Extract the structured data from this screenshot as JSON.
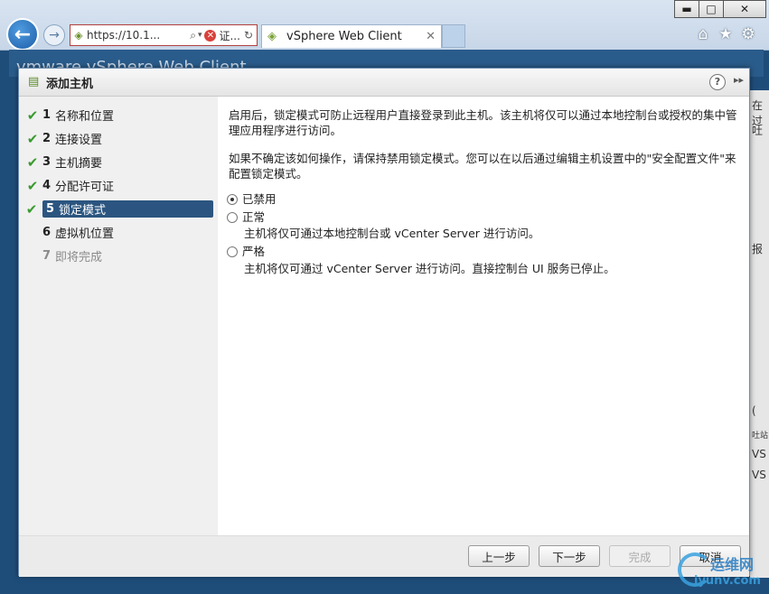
{
  "browser": {
    "address_url": "https://10.1...",
    "cert_text": "证...",
    "tab_title": "vSphere Web Client",
    "win_min": "▬",
    "win_max": "□",
    "win_close": "✕"
  },
  "background": {
    "header_text": "vmware vSphere Web Client",
    "right_fragments": [
      "在过",
      "吐",
      "报",
      "(",
      "吐站",
      "VS",
      "VS"
    ]
  },
  "dialog": {
    "title": "添加主机",
    "help": "?",
    "expand": "▸▸",
    "steps": [
      {
        "num": "1",
        "label": "名称和位置",
        "state": "done"
      },
      {
        "num": "2",
        "label": "连接设置",
        "state": "done"
      },
      {
        "num": "3",
        "label": "主机摘要",
        "state": "done"
      },
      {
        "num": "4",
        "label": "分配许可证",
        "state": "done"
      },
      {
        "num": "5",
        "label": "锁定模式",
        "state": "active"
      },
      {
        "num": "6",
        "label": "虚拟机位置",
        "state": "pending"
      },
      {
        "num": "7",
        "label": "即将完成",
        "state": "future"
      }
    ],
    "content": {
      "para1": "启用后，锁定模式可防止远程用户直接登录到此主机。该主机将仅可以通过本地控制台或授权的集中管理应用程序进行访问。",
      "para2": "如果不确定该如何操作，请保持禁用锁定模式。您可以在以后通过编辑主机设置中的\"安全配置文件\"来配置锁定模式。",
      "options": [
        {
          "label": "已禁用",
          "selected": true,
          "desc": ""
        },
        {
          "label": "正常",
          "selected": false,
          "desc": "主机将仅可通过本地控制台或 vCenter Server 进行访问。"
        },
        {
          "label": "严格",
          "selected": false,
          "desc": "主机将仅可通过 vCenter Server 进行访问。直接控制台 UI 服务已停止。"
        }
      ]
    },
    "buttons": {
      "back": "上一步",
      "next": "下一步",
      "finish": "完成",
      "cancel": "取消"
    }
  },
  "watermark": {
    "line1": "运维网",
    "line2": "iyunv.com"
  }
}
